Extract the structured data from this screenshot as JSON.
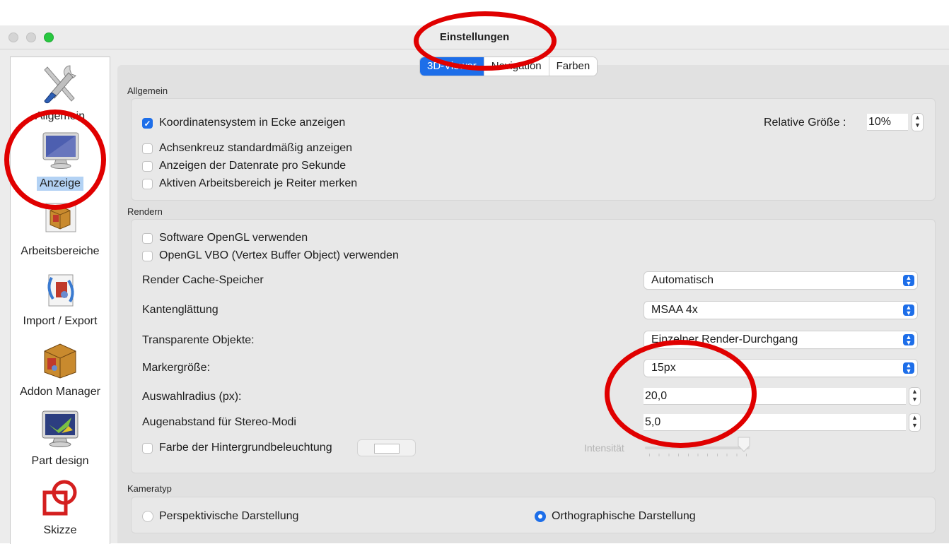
{
  "window": {
    "title": "Einstellungen"
  },
  "sidebar": {
    "items": [
      {
        "label": "Allgemein",
        "icon": "tools-icon"
      },
      {
        "label": "Anzeige",
        "icon": "monitor-icon",
        "selected": true
      },
      {
        "label": "Arbeitsbereiche",
        "icon": "workbench-box-icon"
      },
      {
        "label": "Import / Export",
        "icon": "import-export-icon"
      },
      {
        "label": "Addon Manager",
        "icon": "addon-box-icon"
      },
      {
        "label": "Part design",
        "icon": "part-design-icon"
      },
      {
        "label": "Skizze",
        "icon": "sketch-icon"
      }
    ]
  },
  "tabs": [
    {
      "label": "3D-Viewer",
      "active": true
    },
    {
      "label": "Navigation"
    },
    {
      "label": "Farben"
    }
  ],
  "allgemein": {
    "title": "Allgemein",
    "checkboxes": [
      {
        "label": "Koordinatensystem in Ecke anzeigen",
        "checked": true
      },
      {
        "label": "Achsenkreuz standardmäßig anzeigen",
        "checked": false
      },
      {
        "label": "Anzeigen der Datenrate pro Sekunde",
        "checked": false
      },
      {
        "label": "Aktiven Arbeitsbereich je Reiter merken",
        "checked": false
      }
    ],
    "relative_size_label": "Relative Größe :",
    "relative_size_value": "10%"
  },
  "rendern": {
    "title": "Rendern",
    "checkboxes": [
      {
        "label": "Software OpenGL verwenden",
        "checked": false
      },
      {
        "label": "OpenGL VBO (Vertex Buffer Object) verwenden",
        "checked": false
      }
    ],
    "rows": [
      {
        "label": "Render Cache-Speicher",
        "value": "Automatisch"
      },
      {
        "label": "Kantenglättung",
        "value": "MSAA 4x"
      },
      {
        "label": "Transparente Objekte:",
        "value": "Einzelner Render-Durchgang"
      },
      {
        "label": "Markergröße:",
        "value": "15px"
      }
    ],
    "spins": [
      {
        "label": "Auswahlradius (px):",
        "value": "20,0"
      },
      {
        "label": "Augenabstand für Stereo-Modi",
        "value": "5,0"
      }
    ],
    "backlight_label": "Farbe der Hintergrundbeleuchtung",
    "backlight_checked": false,
    "intensity_label": "Intensität",
    "intensity_level": 1.0
  },
  "kameratyp": {
    "title": "Kameratyp",
    "options": [
      {
        "label": "Perspektivische Darstellung",
        "selected": false
      },
      {
        "label": "Orthographische Darstellung",
        "selected": true
      }
    ]
  },
  "colors": {
    "accent": "#1d6ee9",
    "annotation": "#e00000",
    "selection": "#b3d2f4"
  }
}
